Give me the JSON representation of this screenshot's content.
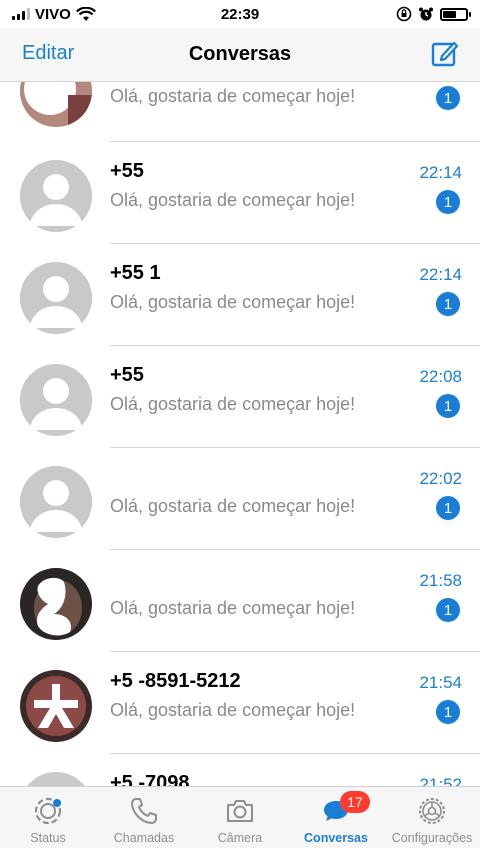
{
  "status_bar": {
    "carrier": "VIVO",
    "time": "22:39"
  },
  "nav": {
    "edit_label": "Editar",
    "title": "Conversas"
  },
  "chats": [
    {
      "name": "",
      "message": "Olá, gostaria de começar hoje!",
      "time": "",
      "unread": "1",
      "avatar": "photo-1"
    },
    {
      "name": "+55 ",
      "message": "Olá, gostaria de começar hoje!",
      "time": "22:14",
      "unread": "1",
      "avatar": "default"
    },
    {
      "name": "+55 1",
      "message": "Olá, gostaria de começar hoje!",
      "time": "22:14",
      "unread": "1",
      "avatar": "default"
    },
    {
      "name": "+55 ",
      "message": "Olá, gostaria de começar hoje!",
      "time": "22:08",
      "unread": "1",
      "avatar": "default"
    },
    {
      "name": "",
      "message": "Olá, gostaria de começar hoje!",
      "time": "22:02",
      "unread": "1",
      "avatar": "default"
    },
    {
      "name": "",
      "message": "Olá, gostaria de começar hoje!",
      "time": "21:58",
      "unread": "1",
      "avatar": "photo-2"
    },
    {
      "name": "+5 -8591-5212",
      "message": "Olá, gostaria de começar hoje!",
      "time": "21:54",
      "unread": "1",
      "avatar": "photo-3"
    },
    {
      "name": "+5 -7098",
      "message": "",
      "time": "21:52",
      "unread": "",
      "avatar": "default"
    }
  ],
  "tabs": [
    {
      "label": "Status",
      "icon": "status-icon"
    },
    {
      "label": "Chamadas",
      "icon": "phone-icon"
    },
    {
      "label": "Câmera",
      "icon": "camera-icon"
    },
    {
      "label": "Conversas",
      "icon": "chats-icon",
      "badge": "17"
    },
    {
      "label": "Configurações",
      "icon": "gear-icon"
    }
  ],
  "colors": {
    "accent": "#1b7ed6",
    "badge": "#ff3b30",
    "muted": "#8e8e93"
  }
}
